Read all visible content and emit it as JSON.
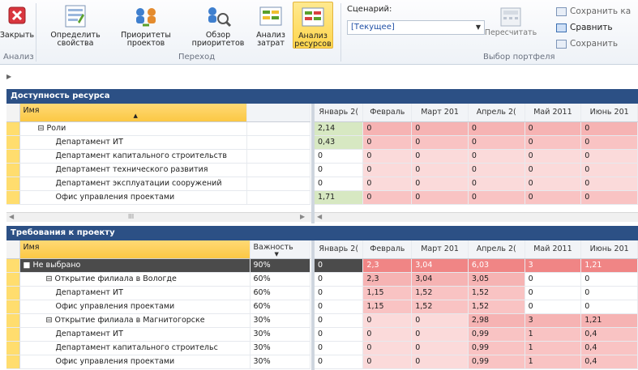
{
  "ribbon": {
    "buttons": [
      {
        "label": "Закрыть",
        "icon": "close-icon"
      },
      {
        "label": "Определить\nсвойства",
        "icon": "properties-icon"
      },
      {
        "label": "Приоритеты\nпроектов",
        "icon": "priorities-icon"
      },
      {
        "label": "Обзор\nприоритетов",
        "icon": "review-priorities-icon"
      },
      {
        "label": "Анализ\nзатрат",
        "icon": "cost-analysis-icon"
      },
      {
        "label": "Анализ\nресурсов",
        "icon": "resource-analysis-icon"
      }
    ],
    "group_analysis": "Анализ",
    "group_transition": "Переход",
    "scenario_label": "Сценарий:",
    "scenario_value": "[Текущее]",
    "recalc_label": "Пересчитать",
    "save_as_label": "Сохранить ка",
    "compare_label": "Сравнить",
    "save_label": "Сохранить",
    "group_portfolio": "Выбор портфеля"
  },
  "availability": {
    "title": "Доступность ресурса",
    "col_name": "Имя",
    "months": [
      "Январь 2(",
      "Февраль",
      "Март 201",
      "Апрель 2(",
      "Май 2011",
      "Июнь 201"
    ],
    "rows": [
      {
        "name": "⊟ Роли",
        "vals": [
          "2,14",
          "0",
          "0",
          "0",
          "0",
          "0"
        ]
      },
      {
        "name": "Департамент ИТ",
        "vals": [
          "0,43",
          "0",
          "0",
          "0",
          "0",
          "0"
        ]
      },
      {
        "name": "Департамент капитального строительств",
        "vals": [
          "0",
          "0",
          "0",
          "0",
          "0",
          "0"
        ]
      },
      {
        "name": "Департамент технического развития",
        "vals": [
          "0",
          "0",
          "0",
          "0",
          "0",
          "0"
        ]
      },
      {
        "name": "Департамент эксплуатации сооружений",
        "vals": [
          "0",
          "0",
          "0",
          "0",
          "0",
          "0"
        ]
      },
      {
        "name": "Офис управления проектами",
        "vals": [
          "1,71",
          "0",
          "0",
          "0",
          "0",
          "0"
        ]
      }
    ],
    "scroll_mark": "III"
  },
  "requirements": {
    "title": "Требования к проекту",
    "col_name": "Имя",
    "col_importance": "Важность",
    "months": [
      "Январь 2(",
      "Февраль",
      "Март 201",
      "Апрель 2(",
      "Май 2011",
      "Июнь 201"
    ],
    "rows": [
      {
        "name": "■ Не выбрано",
        "imp": "90%",
        "vals": [
          "0",
          "2,3",
          "3,04",
          "6,03",
          "3",
          "1,21"
        ]
      },
      {
        "name": "⊟ Открытие филиала в Вологде",
        "imp": "60%",
        "vals": [
          "0",
          "2,3",
          "3,04",
          "3,05",
          "0",
          "0"
        ]
      },
      {
        "name": "Департамент ИТ",
        "imp": "60%",
        "vals": [
          "0",
          "1,15",
          "1,52",
          "1,52",
          "0",
          "0"
        ]
      },
      {
        "name": "Офис управления проектами",
        "imp": "60%",
        "vals": [
          "0",
          "1,15",
          "1,52",
          "1,52",
          "0",
          "0"
        ]
      },
      {
        "name": "⊟ Открытие филиала в Магнитогорске",
        "imp": "30%",
        "vals": [
          "0",
          "0",
          "0",
          "2,98",
          "3",
          "1,21"
        ]
      },
      {
        "name": "Департамент ИТ",
        "imp": "30%",
        "vals": [
          "0",
          "0",
          "0",
          "0,99",
          "1",
          "0,4"
        ]
      },
      {
        "name": "Департамент капитального строительс",
        "imp": "30%",
        "vals": [
          "0",
          "0",
          "0",
          "0,99",
          "1",
          "0,4"
        ]
      },
      {
        "name": "Офис управления проектами",
        "imp": "30%",
        "vals": [
          "0",
          "0",
          "0",
          "0,99",
          "1",
          "0,4"
        ]
      }
    ]
  }
}
